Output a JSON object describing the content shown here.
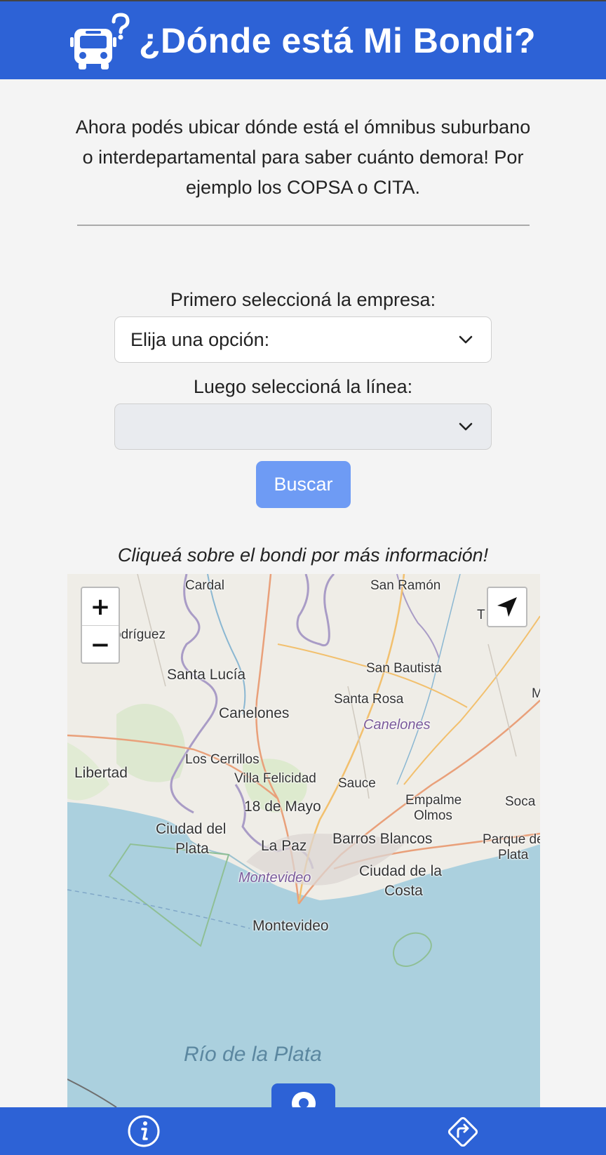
{
  "header": {
    "title": "¿Dónde está Mi Bondi?",
    "logo_icon": "bus-question-icon",
    "background": "#2d62d6"
  },
  "intro": {
    "text": "Ahora podés ubicar dónde está el ómnibus suburbano o interdepartamental para saber cuánto demora! Por ejemplo los COPSA o CITA."
  },
  "form": {
    "company_label": "Primero seleccioná la empresa:",
    "company_select_value": "Elija una opción:",
    "line_label": "Luego seleccioná la línea:",
    "line_select_value": "",
    "search_button": "Buscar",
    "button_color": "#6e9bf4"
  },
  "map": {
    "hint": "Cliqueá sobre el bondi por más información!",
    "zoom_in": "+",
    "zoom_out": "−",
    "places": {
      "cardal": "Cardal",
      "san_ramon": "San Ramón",
      "rodriguez": "odríguez",
      "santa_lucia": "Santa Lucía",
      "san_bautista": "San Bautista",
      "santa_rosa": "Santa Rosa",
      "m": "M",
      "canelones_city": "Canelones",
      "canelones_dept": "Canelones",
      "libertad": "Libertad",
      "los_cerrillos": "Los Cerrillos",
      "villa_felicidad": "Villa Felicidad",
      "sauce": "Sauce",
      "empalme": "Empalme",
      "olmos": "Olmos",
      "soca": "Soca",
      "dieciocho_mayo": "18 de Mayo",
      "ciudad_del": "Ciudad del",
      "plata": "Plata",
      "la_paz": "La Paz",
      "barros_blancos": "Barros Blancos",
      "parque_de": "Parque de",
      "plata2": "Plata",
      "montevideo_dept": "Montevideo",
      "ciudad_de_la": "Ciudad de la",
      "costa": "Costa",
      "montevideo": "Montevideo",
      "rio": "Río de la Plata",
      "t": "T"
    }
  },
  "bottom_nav": {
    "info_icon": "info-icon",
    "map_pin_icon": "map-pin-icon",
    "directions_icon": "directions-icon"
  }
}
